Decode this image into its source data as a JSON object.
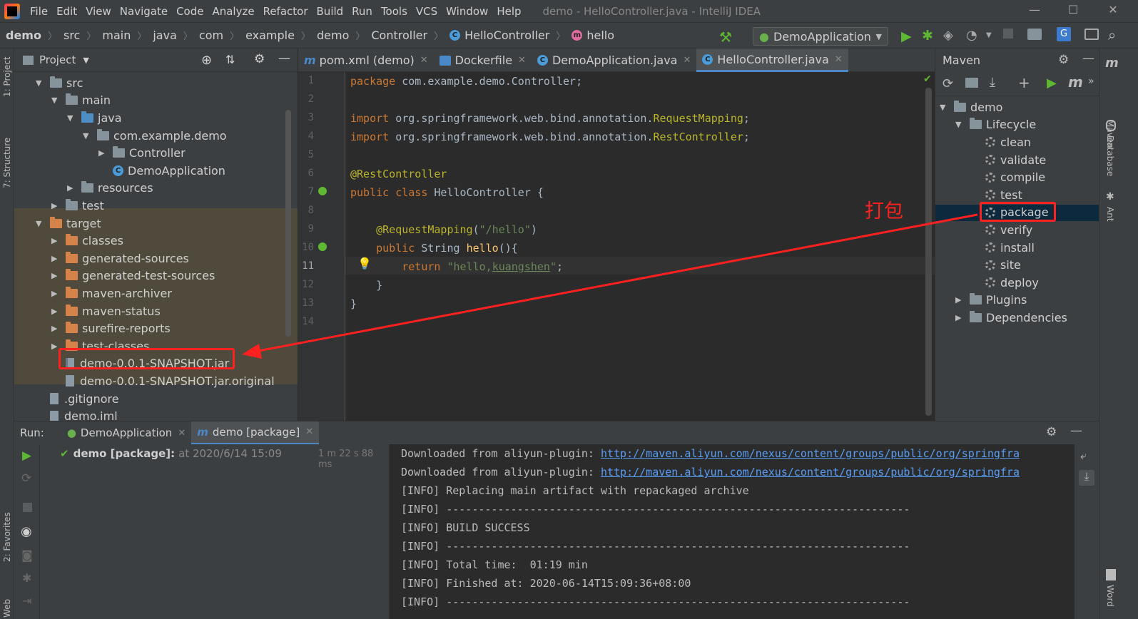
{
  "menu": {
    "items": [
      "File",
      "Edit",
      "View",
      "Navigate",
      "Code",
      "Analyze",
      "Refactor",
      "Build",
      "Run",
      "Tools",
      "VCS",
      "Window",
      "Help"
    ],
    "title": "demo - HelloController.java - IntelliJ IDEA"
  },
  "breadcrumb": [
    "demo",
    "src",
    "main",
    "java",
    "com",
    "example",
    "demo",
    "Controller",
    "HelloController",
    "hello"
  ],
  "run_config": "DemoApplication",
  "left_stripe": {
    "project": "1: Project",
    "structure": "7: Structure",
    "favorites": "2: Favorites",
    "web": "Web"
  },
  "project": {
    "title": "Project",
    "tree": [
      {
        "label": "src",
        "level": 1,
        "expanded": true,
        "kind": "folder"
      },
      {
        "label": "main",
        "level": 2,
        "expanded": true,
        "kind": "folder"
      },
      {
        "label": "java",
        "level": 3,
        "expanded": true,
        "kind": "src-folder"
      },
      {
        "label": "com.example.demo",
        "level": 4,
        "expanded": true,
        "kind": "package"
      },
      {
        "label": "Controller",
        "level": 5,
        "expanded": false,
        "kind": "package"
      },
      {
        "label": "DemoApplication",
        "level": 5,
        "kind": "spring-class"
      },
      {
        "label": "resources",
        "level": 3,
        "expanded": false,
        "kind": "folder"
      },
      {
        "label": "test",
        "level": 2,
        "expanded": false,
        "kind": "folder"
      },
      {
        "label": "target",
        "level": 1,
        "expanded": true,
        "kind": "excluded"
      },
      {
        "label": "classes",
        "level": 2,
        "expanded": false,
        "kind": "excluded"
      },
      {
        "label": "generated-sources",
        "level": 2,
        "expanded": false,
        "kind": "excluded"
      },
      {
        "label": "generated-test-sources",
        "level": 2,
        "expanded": false,
        "kind": "excluded"
      },
      {
        "label": "maven-archiver",
        "level": 2,
        "expanded": false,
        "kind": "excluded"
      },
      {
        "label": "maven-status",
        "level": 2,
        "expanded": false,
        "kind": "excluded"
      },
      {
        "label": "surefire-reports",
        "level": 2,
        "expanded": false,
        "kind": "excluded"
      },
      {
        "label": "test-classes",
        "level": 2,
        "expanded": false,
        "kind": "excluded"
      },
      {
        "label": "demo-0.0.1-SNAPSHOT.jar",
        "level": 2,
        "kind": "jar"
      },
      {
        "label": "demo-0.0.1-SNAPSHOT.jar.original",
        "level": 2,
        "kind": "file"
      },
      {
        "label": ".gitignore",
        "level": 1,
        "kind": "file"
      },
      {
        "label": "demo.iml",
        "level": 1,
        "kind": "file"
      }
    ]
  },
  "editor": {
    "tabs": [
      {
        "label": "pom.xml (demo)",
        "icon": "m",
        "active": false
      },
      {
        "label": "Dockerfile",
        "icon": "docker",
        "active": false
      },
      {
        "label": "DemoApplication.java",
        "icon": "spring",
        "active": false
      },
      {
        "label": "HelloController.java",
        "icon": "class",
        "active": true
      }
    ],
    "line_numbers": [
      "1",
      "2",
      "3",
      "4",
      "5",
      "6",
      "7",
      "8",
      "9",
      "10",
      "11",
      "12",
      "13",
      "14"
    ],
    "current_line": "11"
  },
  "maven": {
    "title": "Maven",
    "root": "demo",
    "lifecycle_label": "Lifecycle",
    "lifecycle": [
      "clean",
      "validate",
      "compile",
      "test",
      "package",
      "verify",
      "install",
      "site",
      "deploy"
    ],
    "selected": "package",
    "plugins": "Plugins",
    "dependencies": "Dependencies"
  },
  "right_stripe": {
    "maven": "Maven",
    "database": "Database",
    "ant": "Ant",
    "word": "Word"
  },
  "annotation": {
    "label": "打包",
    "color": "#ff2020"
  },
  "run": {
    "label": "Run:",
    "tabs": [
      {
        "label": "DemoApplication",
        "active": false
      },
      {
        "label": "demo [package]",
        "active": true
      }
    ],
    "task_name": "demo [package]:",
    "task_time": "at 2020/6/14 15:09",
    "duration": "1 m 22 s 88 ms",
    "console": {
      "dl_prefix": "Downloaded from aliyun-plugin: ",
      "dl_url": "http://maven.aliyun.com/nexus/content/groups/public/org/springfra",
      "lines": [
        "[INFO] Replacing main artifact with repackaged archive",
        "[INFO] ------------------------------------------------------------------------",
        "[INFO] BUILD SUCCESS",
        "[INFO] ------------------------------------------------------------------------",
        "[INFO] Total time:  01:19 min",
        "[INFO] Finished at: 2020-06-14T15:09:36+08:00",
        "[INFO] ------------------------------------------------------------------------"
      ]
    }
  },
  "colors": {
    "accent": "#4a88c7",
    "success": "#5fb832",
    "annotation": "#ff2020",
    "excluded_folder": "#d6824b",
    "folder": "#87939a",
    "src_folder": "#4d8fc4"
  }
}
